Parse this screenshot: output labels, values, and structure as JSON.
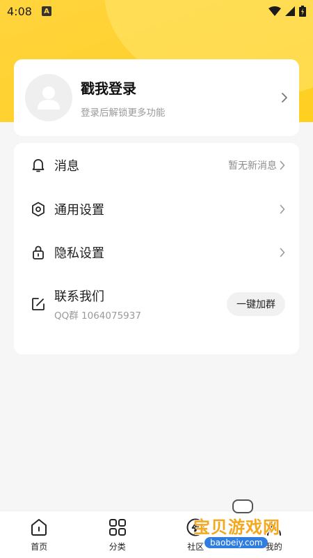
{
  "status_bar": {
    "time": "4:08",
    "notification_badge": "A"
  },
  "profile": {
    "title": "戳我登录",
    "subtitle": "登录后解锁更多功能"
  },
  "menu": {
    "messages": {
      "label": "消息",
      "hint": "暂无新消息"
    },
    "general_settings": {
      "label": "通用设置"
    },
    "privacy_settings": {
      "label": "隐私设置"
    },
    "contact": {
      "label": "联系我们",
      "qq_group": "QQ群 1064075937",
      "join_button": "一键加群"
    }
  },
  "tabs": [
    {
      "label": "首页",
      "icon": "home-icon"
    },
    {
      "label": "分类",
      "icon": "grid-icon"
    },
    {
      "label": "社区",
      "icon": "lightning-icon"
    },
    {
      "label": "我的",
      "icon": "user-icon"
    }
  ],
  "watermark": {
    "text": "宝贝游戏网",
    "url": "baobeiy.com"
  },
  "colors": {
    "accent": "#ffd43d",
    "background": "#f6f6f6",
    "card": "#ffffff",
    "watermark": "#f4a81d"
  }
}
